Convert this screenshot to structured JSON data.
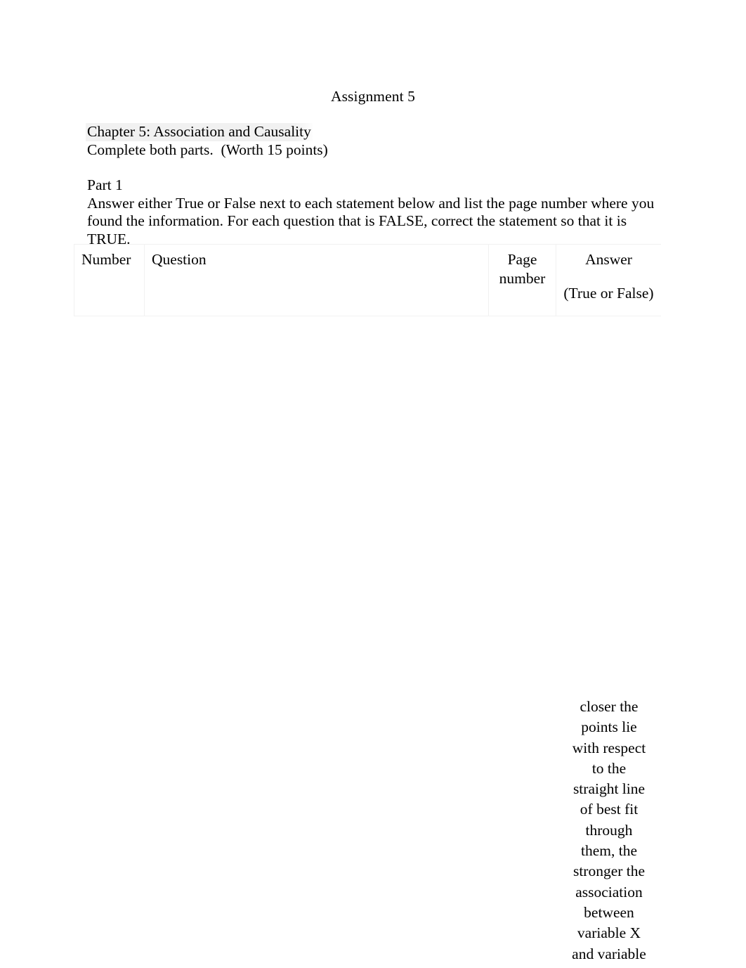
{
  "document": {
    "title": "Assignment 5",
    "intro": {
      "chapter_line": "Chapter 5: Association and Causality",
      "chapter_highlight_color": "#ececec",
      "instructions_line": "Complete both parts.  (Worth 15 points)"
    },
    "part1": {
      "heading": "Part 1",
      "instructions_line1": "Answer either True or False next to each statement below and list the page number where you",
      "instructions_line2": "found the information. For each question that is FALSE, correct the statement so that it is TRUE."
    },
    "table": {
      "border_color": "#f1f1f1",
      "headers": {
        "number": "Number",
        "question": "Question",
        "page_number": "Page number",
        "answer": "Answer",
        "answer_sub": "(True or False)"
      }
    },
    "answer_continued": {
      "lines": [
        "closer the",
        "points lie",
        "with respect",
        "to the",
        "straight line",
        "of best fit",
        "through",
        "them, the",
        "stronger the",
        "association",
        "between",
        "variable X",
        "and variable"
      ]
    }
  }
}
